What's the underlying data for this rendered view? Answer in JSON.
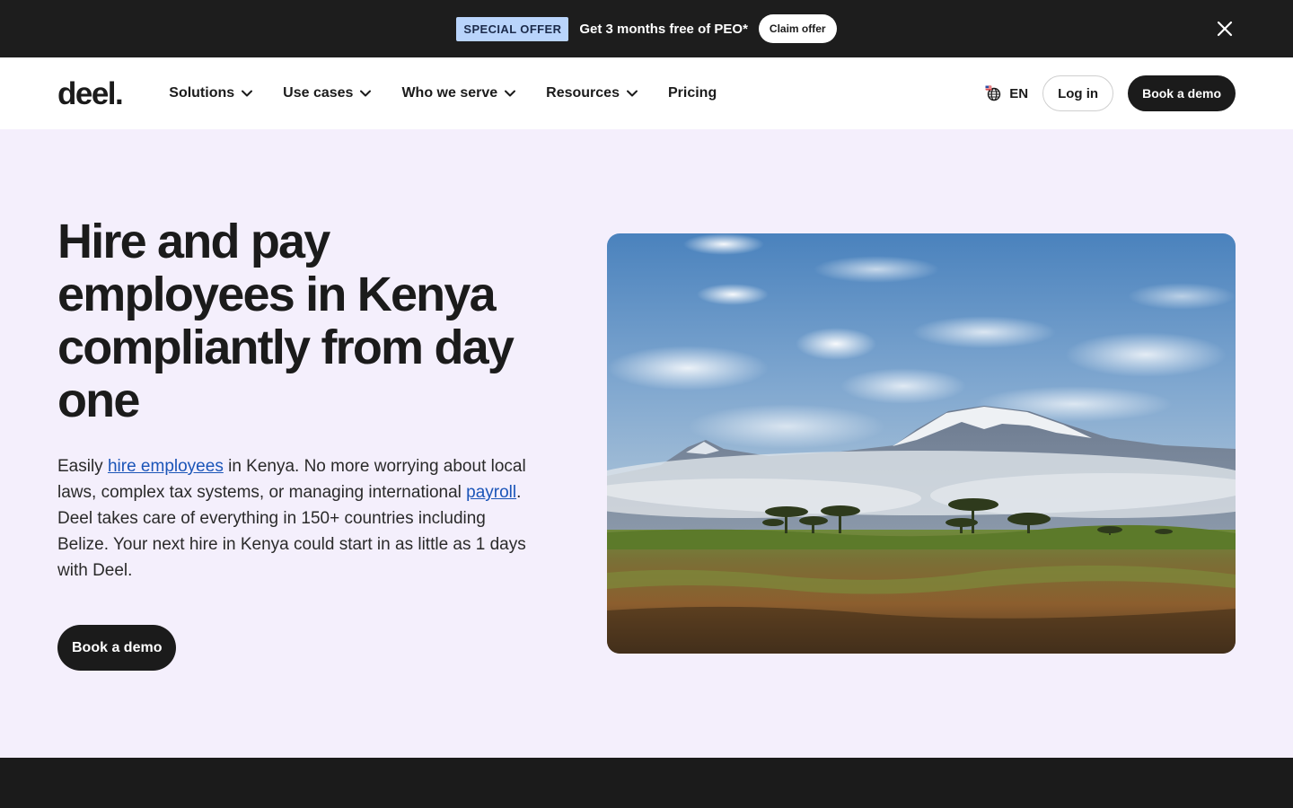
{
  "promo": {
    "badge": "SPECIAL OFFER",
    "text": "Get 3 months free of PEO*",
    "button": "Claim offer"
  },
  "header": {
    "logo": "deel.",
    "nav": [
      {
        "label": "Solutions",
        "has_dropdown": true
      },
      {
        "label": "Use cases",
        "has_dropdown": true
      },
      {
        "label": "Who we serve",
        "has_dropdown": true
      },
      {
        "label": "Resources",
        "has_dropdown": true
      },
      {
        "label": "Pricing",
        "has_dropdown": false
      }
    ],
    "language": "EN",
    "login": "Log in",
    "demo": "Book a demo"
  },
  "hero": {
    "title": "Hire and pay employees in Kenya compliantly from day one",
    "desc_pre": "Easily ",
    "desc_link1": "hire employees",
    "desc_mid": " in Kenya. No more worrying about local laws, complex tax systems, or managing international ",
    "desc_link2": "payroll",
    "desc_post": ". Deel takes care of everything in 150+ countries including Belize. Your next hire in Kenya could start in as little as 1 days with Deel.",
    "cta": "Book a demo",
    "image_alt": "kenya-landscape-mount-kilimanjaro"
  },
  "colors": {
    "promo_bg": "#1d1d1d",
    "badge_bg": "#b9d4fb",
    "hero_bg": "#f4effc",
    "primary": "#1b1b1b",
    "link": "#1b55b8"
  }
}
